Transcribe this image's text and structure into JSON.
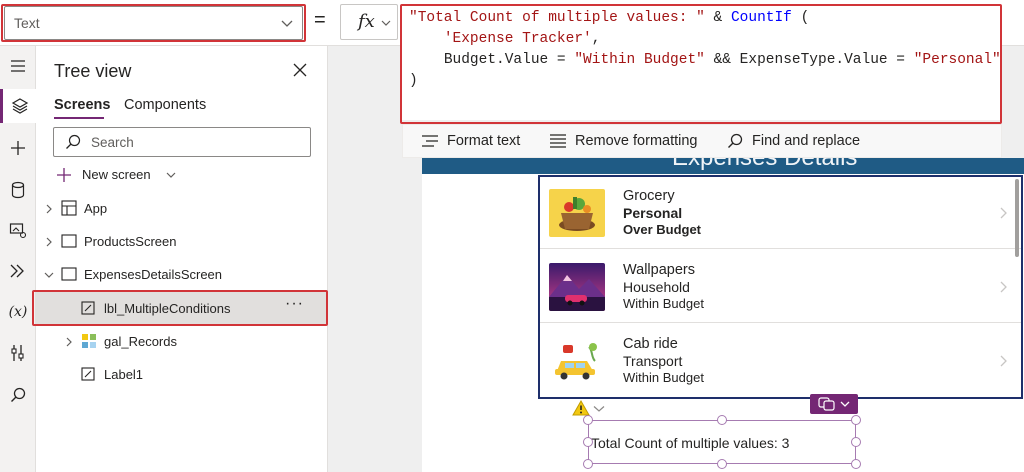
{
  "property_selector": {
    "value": "Text"
  },
  "formula_bar": {
    "equals": "=",
    "fx": "fx",
    "line1_str": "\"Total Count of multiple values: \"",
    "line1_op": " & ",
    "line1_fn": "CountIf",
    "line1_paren": " (",
    "line2_str": "'Expense Tracker'",
    "line2_comma": ",",
    "line3_a": "Budget.Value = ",
    "line3_str1": "\"Within Budget\"",
    "line3_b": " && ExpenseType.Value = ",
    "line3_str2": "\"Personal\"",
    "line4": ")"
  },
  "command_bar": {
    "format_text": "Format text",
    "remove_formatting": "Remove formatting",
    "find_replace": "Find and replace"
  },
  "tree_view": {
    "title": "Tree view",
    "tabs": [
      "Screens",
      "Components"
    ],
    "search_placeholder": "Search",
    "new_screen": "New screen",
    "nodes": {
      "app": "App",
      "products_screen": "ProductsScreen",
      "expenses_details_screen": "ExpensesDetailsScreen",
      "lbl_multiple_conditions": "lbl_MultipleConditions",
      "gal_records": "gal_Records",
      "label1": "Label1"
    },
    "more": "···"
  },
  "canvas": {
    "header_title": "Expenses Details",
    "gallery": [
      {
        "title": "Grocery",
        "type": "Personal",
        "budget": "Over Budget",
        "image": "grocery-basket"
      },
      {
        "title": "Wallpapers",
        "type": "Household",
        "budget": "Within Budget",
        "image": "mountain-car"
      },
      {
        "title": "Cab ride",
        "type": "Transport",
        "budget": "Within Budget",
        "image": "taxi-cab"
      }
    ],
    "result_label": "Total Count of multiple values: 3"
  },
  "colors": {
    "accent": "#742774",
    "highlight_red": "#d13438",
    "gallery_border": "#1e2f6b",
    "header_band": "#1f5b85",
    "string_literal": "#a31515",
    "function": "#0000ff"
  }
}
